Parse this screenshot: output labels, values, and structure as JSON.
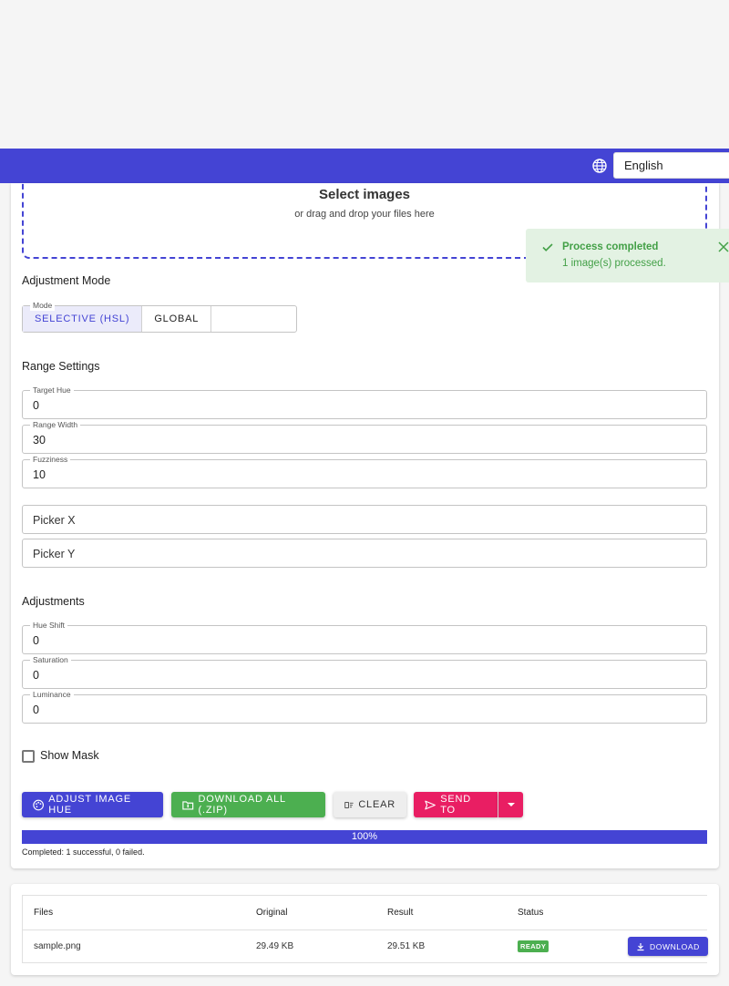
{
  "header": {
    "language": "English"
  },
  "upload": {
    "title": "Select images",
    "subtitle": "or drag and drop your files here"
  },
  "toast": {
    "title": "Process completed",
    "message": "1 image(s) processed."
  },
  "mode": {
    "section_title": "Adjustment Mode",
    "legend": "Mode",
    "options": [
      "SELECTIVE (HSL)",
      "GLOBAL"
    ],
    "selected": "SELECTIVE (HSL)"
  },
  "range": {
    "section_title": "Range Settings",
    "target_hue": {
      "label": "Target Hue",
      "value": "0"
    },
    "range_width": {
      "label": "Range Width",
      "value": "30"
    },
    "fuzziness": {
      "label": "Fuzziness",
      "value": "10"
    },
    "picker_x": {
      "placeholder": "Picker X"
    },
    "picker_y": {
      "placeholder": "Picker Y"
    }
  },
  "adjustments": {
    "section_title": "Adjustments",
    "hue_shift": {
      "label": "Hue Shift",
      "value": "0"
    },
    "saturation": {
      "label": "Saturation",
      "value": "0"
    },
    "luminance": {
      "label": "Luminance",
      "value": "0"
    }
  },
  "show_mask": {
    "label": "Show Mask",
    "checked": false
  },
  "actions": {
    "adjust": "ADJUST IMAGE HUE",
    "download_all": "DOWNLOAD ALL (.ZIP)",
    "clear": "CLEAR",
    "send_to": "SEND TO"
  },
  "progress": {
    "value": 100,
    "label": "100%",
    "status": "Completed: 1 successful, 0 failed."
  },
  "results": {
    "columns": [
      "Files",
      "Original",
      "Result",
      "Status"
    ],
    "rows": [
      {
        "file": "sample.png",
        "original": "29.49 KB",
        "result": "29.51 KB",
        "status": "READY",
        "action": "DOWNLOAD"
      }
    ]
  },
  "colors": {
    "primary": "#4444d4",
    "success": "#4caf50",
    "accent": "#e91e63"
  }
}
